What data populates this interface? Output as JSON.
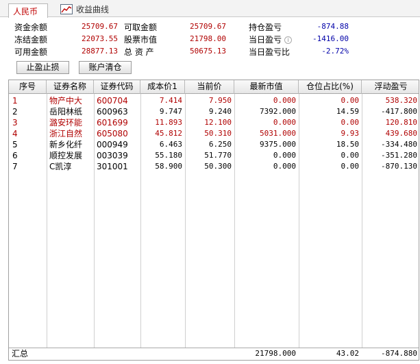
{
  "tabs": {
    "rmb": "人民币",
    "curve": "收益曲线"
  },
  "summary": {
    "cash_balance_label": "资金余额",
    "cash_balance": "25709.67",
    "withdrawable_label": "可取金额",
    "withdrawable": "25709.67",
    "position_pnl_label": "持仓盈亏",
    "position_pnl": "-874.88",
    "frozen_label": "冻结金额",
    "frozen": "22073.55",
    "stock_value_label": "股票市值",
    "stock_value": "21798.00",
    "today_pnl_label": "当日盈亏",
    "today_pnl": "-1416.00",
    "available_label": "可用金额",
    "available": "28877.13",
    "total_assets_label": "总 资 产",
    "total_assets": "50675.13",
    "today_pnl_ratio_label": "当日盈亏比",
    "today_pnl_ratio": "-2.72%"
  },
  "buttons": {
    "stop": "止盈止损",
    "clear": "账户清仓"
  },
  "table": {
    "headers": [
      "序号",
      "证券名称",
      "证券代码",
      "成本价1",
      "当前价",
      "最新市值",
      "仓位占比(%)",
      "浮动盈亏"
    ],
    "rows": [
      {
        "no": "1",
        "name": "物产中大",
        "code": "600704",
        "cost": "7.414",
        "price": "7.950",
        "mv": "0.000",
        "pct": "0.00",
        "pnl": "538.320",
        "color": "red"
      },
      {
        "no": "2",
        "name": "岳阳林纸",
        "code": "600963",
        "cost": "9.747",
        "price": "9.240",
        "mv": "7392.000",
        "pct": "14.59",
        "pnl": "-417.800",
        "color": "black"
      },
      {
        "no": "3",
        "name": "潞安环能",
        "code": "601699",
        "cost": "11.893",
        "price": "12.100",
        "mv": "0.000",
        "pct": "0.00",
        "pnl": "120.810",
        "color": "red"
      },
      {
        "no": "4",
        "name": "浙江自然",
        "code": "605080",
        "cost": "45.812",
        "price": "50.310",
        "mv": "5031.000",
        "pct": "9.93",
        "pnl": "439.680",
        "color": "red"
      },
      {
        "no": "5",
        "name": "新乡化纤",
        "code": "000949",
        "cost": "6.463",
        "price": "6.250",
        "mv": "9375.000",
        "pct": "18.50",
        "pnl": "-334.480",
        "color": "black"
      },
      {
        "no": "6",
        "name": "顺控发展",
        "code": "003039",
        "cost": "55.180",
        "price": "51.770",
        "mv": "0.000",
        "pct": "0.00",
        "pnl": "-351.280",
        "color": "black"
      },
      {
        "no": "7",
        "name": "C凯淳",
        "code": "301001",
        "cost": "58.900",
        "price": "50.300",
        "mv": "0.000",
        "pct": "0.00",
        "pnl": "-870.130",
        "color": "black"
      }
    ],
    "total": {
      "label": "汇总",
      "mv": "21798.000",
      "pct": "43.02",
      "pnl": "-874.880"
    }
  },
  "colors": {
    "up": "#b00000",
    "down": "#000000",
    "blue_value": "#0000a8"
  }
}
